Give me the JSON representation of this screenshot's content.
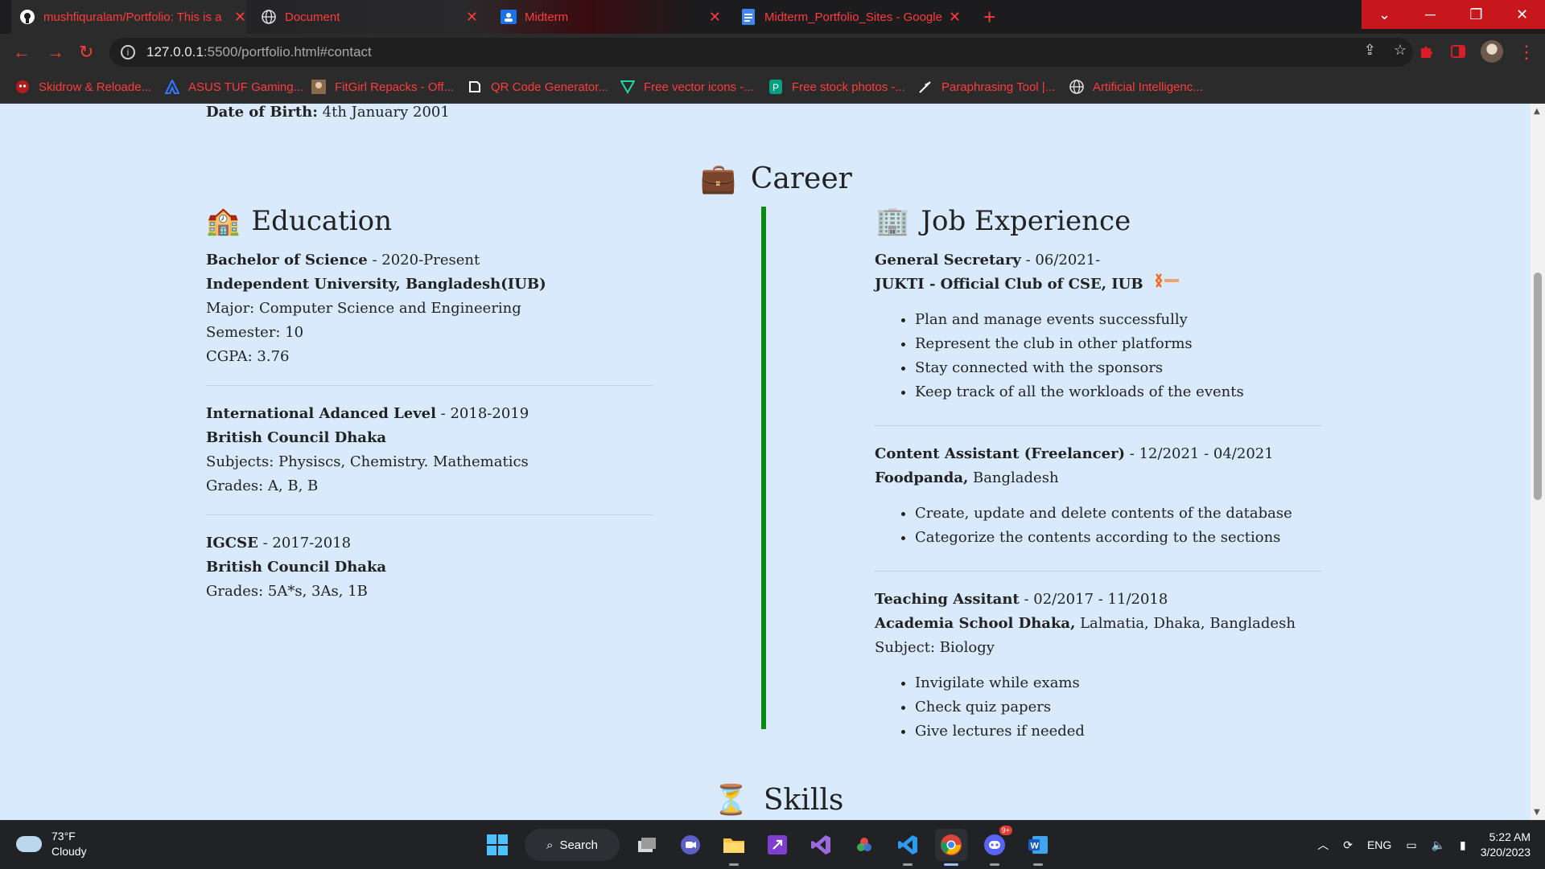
{
  "browser": {
    "tabs": [
      {
        "title": "mushfiquralam/Portfolio: This is a",
        "icon": "github-icon"
      },
      {
        "title": "Document",
        "icon": "globe-icon"
      },
      {
        "title": "Midterm",
        "icon": "classroom-icon"
      },
      {
        "title": "Midterm_Portfolio_Sites - Google",
        "icon": "docs-icon"
      }
    ],
    "url_host": "127.0.0.1",
    "url_path": ":5500/portfolio.html#contact",
    "bookmarks": [
      "Skidrow & Reloade...",
      "ASUS TUF Gaming...",
      "FitGirl Repacks - Off...",
      "QR Code Generator...",
      "Free vector icons -...",
      "Free stock photos -...",
      "Paraphrasing Tool |...",
      "Artificial Intelligenc..."
    ]
  },
  "page": {
    "dob_label": "Date of Birth:",
    "dob_value": " 4th January 2001",
    "career_emoji": "💼",
    "career_title": "Career",
    "education_emoji": "🏫",
    "education_title": "Education",
    "job_emoji": "🏢",
    "job_title": "Job Experience",
    "skills_emoji": "⏳",
    "skills_title": "Skills",
    "education": [
      {
        "degree": "Bachelor of Science",
        "period": " - 2020-Present",
        "institution": "Independent University, Bangladesh(IUB)",
        "lines": [
          "Major: Computer Science and Engineering",
          "Semester: 10",
          "CGPA: 3.76"
        ]
      },
      {
        "degree": "International Adanced Level",
        "period": " - 2018-2019",
        "institution": "British Council Dhaka",
        "lines": [
          "Subjects: Physiscs, Chemistry. Mathematics",
          "Grades: A, B, B"
        ]
      },
      {
        "degree": "IGCSE",
        "period": " - 2017-2018",
        "institution": "British Council Dhaka",
        "lines": [
          "Grades: 5A*s, 3As, 1B"
        ]
      }
    ],
    "jobs": [
      {
        "role": "General Secretary",
        "period": " - 06/2021-",
        "org": "JUKTI - Official Club of CSE, IUB",
        "org_rest": "",
        "extra": "",
        "bullets": [
          "Plan and manage events successfully",
          "Represent the club in other platforms",
          "Stay connected with the sponsors",
          "Keep track of all the workloads of the events"
        ]
      },
      {
        "role": "Content Assistant (Freelancer)",
        "period": " - 12/2021 - 04/2021",
        "org": "Foodpanda,",
        "org_rest": " Bangladesh",
        "extra": "",
        "bullets": [
          "Create, update and delete contents of the database",
          "Categorize the contents according to the sections"
        ]
      },
      {
        "role": "Teaching Assitant",
        "period": " - 02/2017 - 11/2018",
        "org": "Academia School Dhaka,",
        "org_rest": " Lalmatia, Dhaka, Bangladesh",
        "extra": "Subject: Biology",
        "bullets": [
          "Invigilate while exams",
          "Check quiz papers",
          "Give lectures if needed"
        ]
      }
    ]
  },
  "taskbar": {
    "temp": "73°F",
    "condition": "Cloudy",
    "search_label": "Search",
    "lang": "ENG",
    "time": "5:22 AM",
    "date": "3/20/2023",
    "discord_badge": "9+"
  },
  "colors": {
    "accent_red": "#ff3b3b",
    "page_bg": "#d8eafb",
    "career_divider": "#0b8a12"
  }
}
